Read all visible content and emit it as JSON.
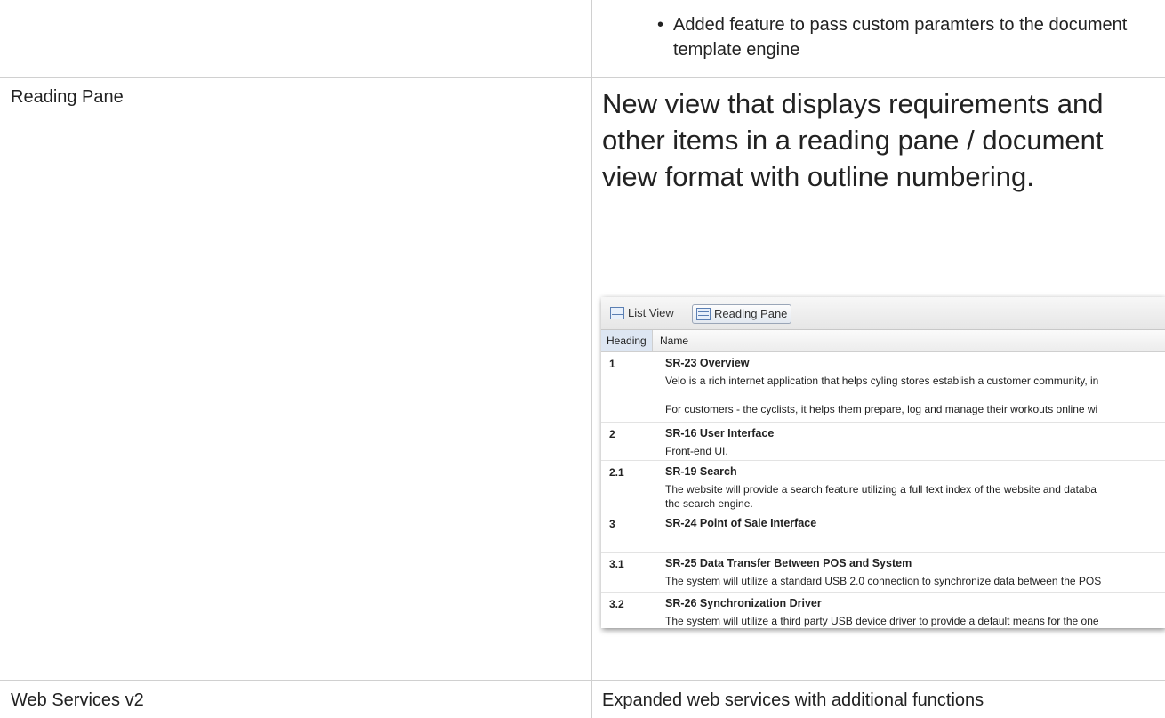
{
  "rows": [
    {
      "bullet": "Added feature to pass custom paramters to the document template engine"
    },
    {
      "feature": "Reading Pane",
      "description": "New view that displays requirements and other items in a reading pane / document view format with outline numbering."
    },
    {
      "feature": "Web Services v2",
      "description": "Expanded web services with additional functions"
    }
  ],
  "screenshot": {
    "toolbar": {
      "list_view": "List View",
      "reading_pane": "Reading Pane"
    },
    "columns": {
      "heading": "Heading",
      "name": "Name"
    },
    "items": [
      {
        "num": "1",
        "title": "SR-23 Overview",
        "desc": "Velo is a rich internet application that helps cyling stores establish a customer community, in\n\nFor customers - the cyclists, it helps them prepare, log and manage their workouts online wi"
      },
      {
        "num": "2",
        "title": "SR-16 User Interface",
        "desc": "Front-end UI."
      },
      {
        "num": "2.1",
        "title": "SR-19 Search",
        "desc": "The website will provide a search feature utilizing a full text index of the website and databa\nthe search engine."
      },
      {
        "num": "3",
        "title": "SR-24 Point of Sale Interface",
        "desc": ""
      },
      {
        "num": "3.1",
        "title": "SR-25 Data Transfer Between POS and System",
        "desc": "The system will utilize a standard USB 2.0 connection to synchronize data between the POS"
      },
      {
        "num": "3.2",
        "title": "SR-26 Synchronization Driver",
        "desc": "The system will utilize a third party USB device driver to provide a default means for the one"
      }
    ]
  }
}
